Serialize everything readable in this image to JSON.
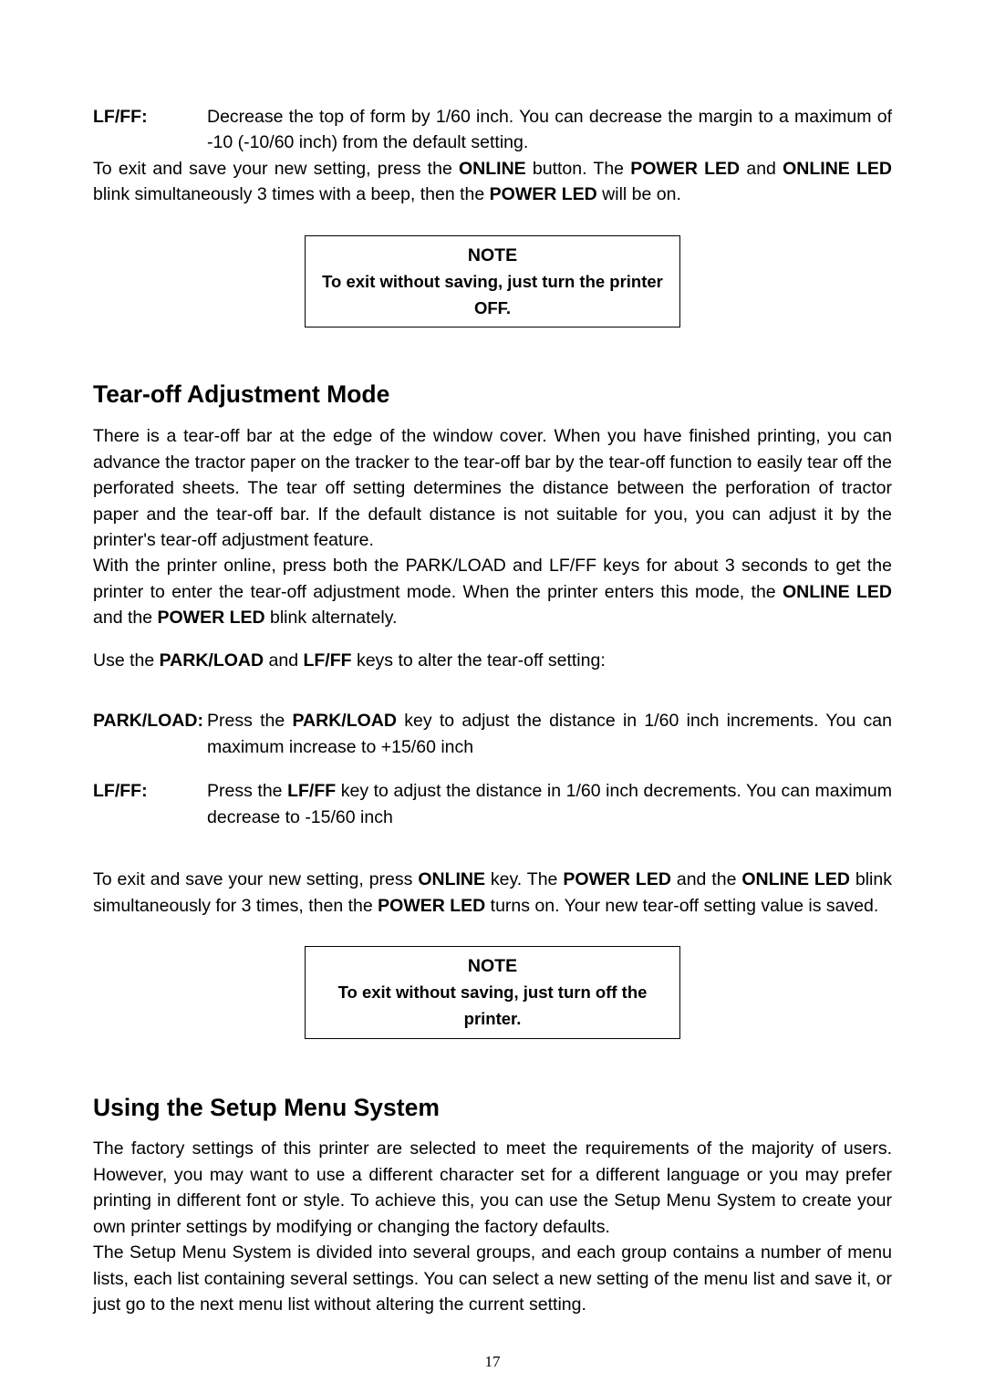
{
  "top_def": {
    "label": "LF/FF:",
    "body": "Decrease the top of form by 1/60 inch. You can decrease the margin to a maximum of -10 (-10/60 inch) from the default setting."
  },
  "exit_save_runs": [
    {
      "t": "To exit and save your new setting, press the ",
      "b": false
    },
    {
      "t": "ONLINE",
      "b": true
    },
    {
      "t": " button. The ",
      "b": false
    },
    {
      "t": "POWER LED",
      "b": true
    },
    {
      "t": " and ",
      "b": false
    },
    {
      "t": "ONLINE LED",
      "b": true
    },
    {
      "t": " blink simultaneously 3 times with a beep, then the ",
      "b": false
    },
    {
      "t": "POWER LED",
      "b": true
    },
    {
      "t": " will be on.",
      "b": false
    }
  ],
  "note1": {
    "title": "NOTE",
    "body": "To exit without saving, just turn the printer OFF."
  },
  "tearoff": {
    "heading": "Tear-off Adjustment Mode",
    "para1": "There is a tear-off bar at the edge of the window cover.   When you have finished printing, you can advance the tractor paper on the tracker to the tear-off bar by the tear-off function to easily tear off the perforated sheets. The tear off setting determines the distance between the perforation of tractor paper and the tear-off bar. If the default distance is not suitable for you, you can adjust it by the printer's tear-off adjustment feature.",
    "para2_runs": [
      {
        "t": "With the printer online, press both the PARK/LOAD and LF/FF keys for about 3 seconds to get the printer to enter the tear-off adjustment mode. When the printer enters this mode, the ",
        "b": false
      },
      {
        "t": "ONLINE LED",
        "b": true
      },
      {
        "t": " and the ",
        "b": false
      },
      {
        "t": "POWER LED",
        "b": true
      },
      {
        "t": " blink alternately.",
        "b": false
      }
    ],
    "use_keys_runs": [
      {
        "t": "Use the ",
        "b": false
      },
      {
        "t": "PARK/LOAD",
        "b": true
      },
      {
        "t": " and ",
        "b": false
      },
      {
        "t": "LF/FF",
        "b": true
      },
      {
        "t": " keys to alter the tear-off setting:",
        "b": false
      }
    ],
    "defs": [
      {
        "label": "PARK/LOAD:",
        "body_runs": [
          {
            "t": "Press the ",
            "b": false
          },
          {
            "t": "PARK/LOAD",
            "b": true
          },
          {
            "t": " key to adjust the distance in 1/60 inch increments. You can maximum increase to +15/60 inch",
            "b": false
          }
        ]
      },
      {
        "label": "LF/FF:",
        "body_runs": [
          {
            "t": "Press the ",
            "b": false
          },
          {
            "t": "LF/FF",
            "b": true
          },
          {
            "t": " key to adjust the distance in 1/60 inch decrements. You can maximum decrease to -15/60 inch",
            "b": false
          }
        ]
      }
    ],
    "save_runs": [
      {
        "t": "To exit and save your new setting, press ",
        "b": false
      },
      {
        "t": "ONLINE",
        "b": true
      },
      {
        "t": " key. The ",
        "b": false
      },
      {
        "t": "POWER LED",
        "b": true
      },
      {
        "t": " and the ",
        "b": false
      },
      {
        "t": "ONLINE LED",
        "b": true
      },
      {
        "t": " blink simultaneously for 3 times, then the ",
        "b": false
      },
      {
        "t": "POWER LED",
        "b": true
      },
      {
        "t": " turns on. Your new tear-off setting value is saved.",
        "b": false
      }
    ]
  },
  "note2": {
    "title": "NOTE",
    "body": "To exit without saving, just turn off the printer."
  },
  "setup": {
    "heading": "Using the Setup Menu System",
    "para1": "The factory settings of this printer are selected to meet the requirements of the majority of users. However, you may want to use a different character set for a different language or you may prefer printing in different font or style. To achieve this, you can use the Setup Menu System to create your own printer settings by modifying or changing the factory defaults.",
    "para2": "The Setup Menu System is divided into several groups, and each group contains a number of menu lists, each list containing several settings. You can select a new setting of the menu list and save it, or just go to the next menu list without altering the current setting."
  },
  "page_number": "17"
}
